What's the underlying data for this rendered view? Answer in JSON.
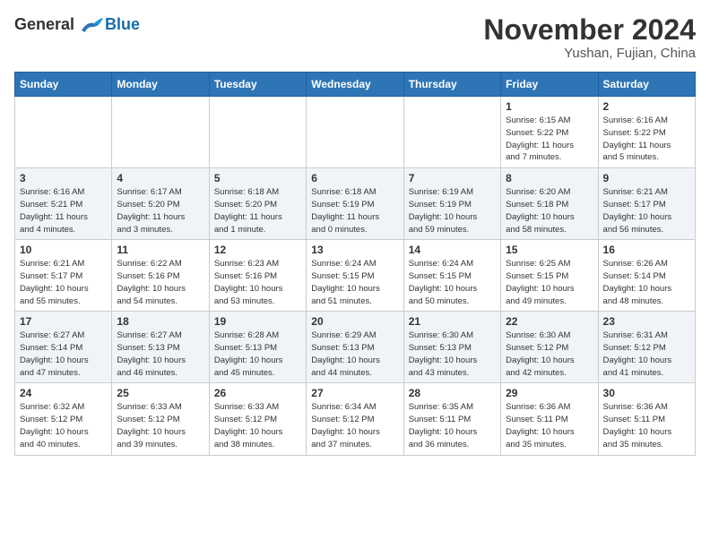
{
  "header": {
    "logo_general": "General",
    "logo_blue": "Blue",
    "month_title": "November 2024",
    "location": "Yushan, Fujian, China"
  },
  "calendar": {
    "weekdays": [
      "Sunday",
      "Monday",
      "Tuesday",
      "Wednesday",
      "Thursday",
      "Friday",
      "Saturday"
    ],
    "weeks": [
      [
        {
          "day": "",
          "info": ""
        },
        {
          "day": "",
          "info": ""
        },
        {
          "day": "",
          "info": ""
        },
        {
          "day": "",
          "info": ""
        },
        {
          "day": "",
          "info": ""
        },
        {
          "day": "1",
          "info": "Sunrise: 6:15 AM\nSunset: 5:22 PM\nDaylight: 11 hours\nand 7 minutes."
        },
        {
          "day": "2",
          "info": "Sunrise: 6:16 AM\nSunset: 5:22 PM\nDaylight: 11 hours\nand 5 minutes."
        }
      ],
      [
        {
          "day": "3",
          "info": "Sunrise: 6:16 AM\nSunset: 5:21 PM\nDaylight: 11 hours\nand 4 minutes."
        },
        {
          "day": "4",
          "info": "Sunrise: 6:17 AM\nSunset: 5:20 PM\nDaylight: 11 hours\nand 3 minutes."
        },
        {
          "day": "5",
          "info": "Sunrise: 6:18 AM\nSunset: 5:20 PM\nDaylight: 11 hours\nand 1 minute."
        },
        {
          "day": "6",
          "info": "Sunrise: 6:18 AM\nSunset: 5:19 PM\nDaylight: 11 hours\nand 0 minutes."
        },
        {
          "day": "7",
          "info": "Sunrise: 6:19 AM\nSunset: 5:19 PM\nDaylight: 10 hours\nand 59 minutes."
        },
        {
          "day": "8",
          "info": "Sunrise: 6:20 AM\nSunset: 5:18 PM\nDaylight: 10 hours\nand 58 minutes."
        },
        {
          "day": "9",
          "info": "Sunrise: 6:21 AM\nSunset: 5:17 PM\nDaylight: 10 hours\nand 56 minutes."
        }
      ],
      [
        {
          "day": "10",
          "info": "Sunrise: 6:21 AM\nSunset: 5:17 PM\nDaylight: 10 hours\nand 55 minutes."
        },
        {
          "day": "11",
          "info": "Sunrise: 6:22 AM\nSunset: 5:16 PM\nDaylight: 10 hours\nand 54 minutes."
        },
        {
          "day": "12",
          "info": "Sunrise: 6:23 AM\nSunset: 5:16 PM\nDaylight: 10 hours\nand 53 minutes."
        },
        {
          "day": "13",
          "info": "Sunrise: 6:24 AM\nSunset: 5:15 PM\nDaylight: 10 hours\nand 51 minutes."
        },
        {
          "day": "14",
          "info": "Sunrise: 6:24 AM\nSunset: 5:15 PM\nDaylight: 10 hours\nand 50 minutes."
        },
        {
          "day": "15",
          "info": "Sunrise: 6:25 AM\nSunset: 5:15 PM\nDaylight: 10 hours\nand 49 minutes."
        },
        {
          "day": "16",
          "info": "Sunrise: 6:26 AM\nSunset: 5:14 PM\nDaylight: 10 hours\nand 48 minutes."
        }
      ],
      [
        {
          "day": "17",
          "info": "Sunrise: 6:27 AM\nSunset: 5:14 PM\nDaylight: 10 hours\nand 47 minutes."
        },
        {
          "day": "18",
          "info": "Sunrise: 6:27 AM\nSunset: 5:13 PM\nDaylight: 10 hours\nand 46 minutes."
        },
        {
          "day": "19",
          "info": "Sunrise: 6:28 AM\nSunset: 5:13 PM\nDaylight: 10 hours\nand 45 minutes."
        },
        {
          "day": "20",
          "info": "Sunrise: 6:29 AM\nSunset: 5:13 PM\nDaylight: 10 hours\nand 44 minutes."
        },
        {
          "day": "21",
          "info": "Sunrise: 6:30 AM\nSunset: 5:13 PM\nDaylight: 10 hours\nand 43 minutes."
        },
        {
          "day": "22",
          "info": "Sunrise: 6:30 AM\nSunset: 5:12 PM\nDaylight: 10 hours\nand 42 minutes."
        },
        {
          "day": "23",
          "info": "Sunrise: 6:31 AM\nSunset: 5:12 PM\nDaylight: 10 hours\nand 41 minutes."
        }
      ],
      [
        {
          "day": "24",
          "info": "Sunrise: 6:32 AM\nSunset: 5:12 PM\nDaylight: 10 hours\nand 40 minutes."
        },
        {
          "day": "25",
          "info": "Sunrise: 6:33 AM\nSunset: 5:12 PM\nDaylight: 10 hours\nand 39 minutes."
        },
        {
          "day": "26",
          "info": "Sunrise: 6:33 AM\nSunset: 5:12 PM\nDaylight: 10 hours\nand 38 minutes."
        },
        {
          "day": "27",
          "info": "Sunrise: 6:34 AM\nSunset: 5:12 PM\nDaylight: 10 hours\nand 37 minutes."
        },
        {
          "day": "28",
          "info": "Sunrise: 6:35 AM\nSunset: 5:11 PM\nDaylight: 10 hours\nand 36 minutes."
        },
        {
          "day": "29",
          "info": "Sunrise: 6:36 AM\nSunset: 5:11 PM\nDaylight: 10 hours\nand 35 minutes."
        },
        {
          "day": "30",
          "info": "Sunrise: 6:36 AM\nSunset: 5:11 PM\nDaylight: 10 hours\nand 35 minutes."
        }
      ]
    ]
  }
}
